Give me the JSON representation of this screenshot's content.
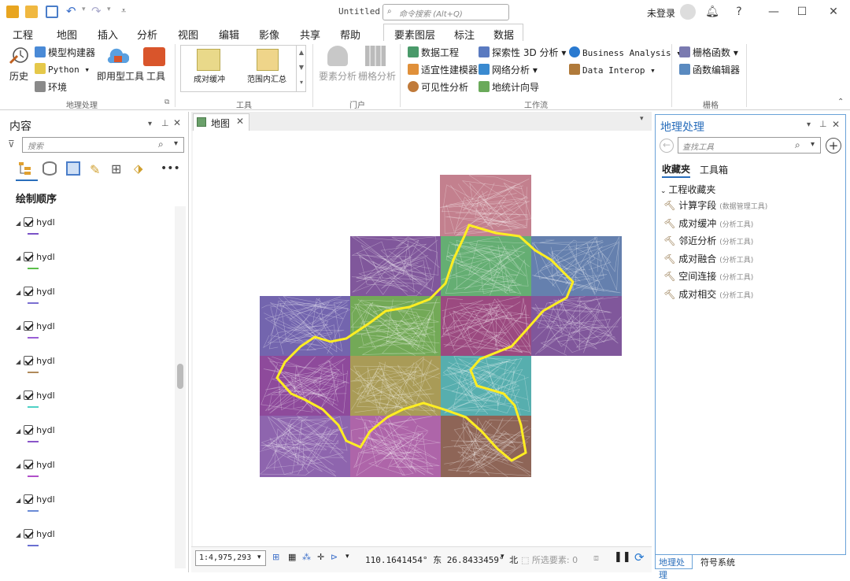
{
  "titlebar": {
    "doc_title": "Untitled",
    "search_placeholder": "命令搜索 (Alt+Q)",
    "login": "未登录",
    "help": "?"
  },
  "tabs": [
    "工程",
    "地图",
    "插入",
    "分析",
    "视图",
    "编辑",
    "影像",
    "共享",
    "帮助"
  ],
  "context_tabs": [
    "要素图层",
    "标注",
    "数据"
  ],
  "ribbon": {
    "geoprocessing": {
      "history": "历史",
      "model_builder": "模型构建器",
      "python": "Python",
      "environments": "环境",
      "ready_tools": "即用型工具",
      "tools": "工具",
      "label": "地理处理"
    },
    "tools_gallery": {
      "items": [
        "成对缓冲",
        "范围内汇总"
      ],
      "label": "工具"
    },
    "portal": {
      "feature_analysis": "要素分析",
      "raster_analysis": "栅格分析",
      "label": "门户"
    },
    "workflows": {
      "data_engineering": "数据工程",
      "suitability": "适宜性建模器",
      "visibility": "可见性分析",
      "exploratory_3d": "探索性 3D 分析",
      "network": "网络分析",
      "geostat": "地统计向导",
      "business": "Business Analysis",
      "data_interop": "Data Interop",
      "label": "工作流"
    },
    "raster": {
      "functions": "栅格函数",
      "function_editor": "函数编辑器",
      "label": "栅格"
    }
  },
  "contents": {
    "title": "内容",
    "search_placeholder": "搜索",
    "drawing_order": "绘制顺序",
    "layers": [
      {
        "name": "hydl",
        "color": "#7a52c7"
      },
      {
        "name": "hydl",
        "color": "#5bbf4b"
      },
      {
        "name": "hydl",
        "color": "#7a6fd1"
      },
      {
        "name": "hydl",
        "color": "#9a5fd6"
      },
      {
        "name": "hydl",
        "color": "#b08a5a"
      },
      {
        "name": "hydl",
        "color": "#4fd1c5"
      },
      {
        "name": "hydl",
        "color": "#8a55c9"
      },
      {
        "name": "hydl",
        "color": "#b04fc9"
      },
      {
        "name": "hydl",
        "color": "#6a8ad6"
      },
      {
        "name": "hydl",
        "color": "#6a6fd1"
      }
    ]
  },
  "map": {
    "tab_label": "地图",
    "scale": "1:4,975,293",
    "coords": "110.1641454° 东 26.8433459° 北",
    "selected": "所选要素: 0"
  },
  "geoprocessing_pane": {
    "title": "地理处理",
    "search_placeholder": "查找工具",
    "tabs": [
      "收藏夹",
      "工具箱"
    ],
    "group": "工程收藏夹",
    "favorites": [
      {
        "name": "计算字段",
        "box": "(数据管理工具)"
      },
      {
        "name": "成对缓冲",
        "box": "(分析工具)"
      },
      {
        "name": "邻近分析",
        "box": "(分析工具)"
      },
      {
        "name": "成对融合",
        "box": "(分析工具)"
      },
      {
        "name": "空间连接",
        "box": "(分析工具)"
      },
      {
        "name": "成对相交",
        "box": "(分析工具)"
      }
    ],
    "bottom_tabs": [
      "地理处理",
      "符号系统"
    ]
  }
}
